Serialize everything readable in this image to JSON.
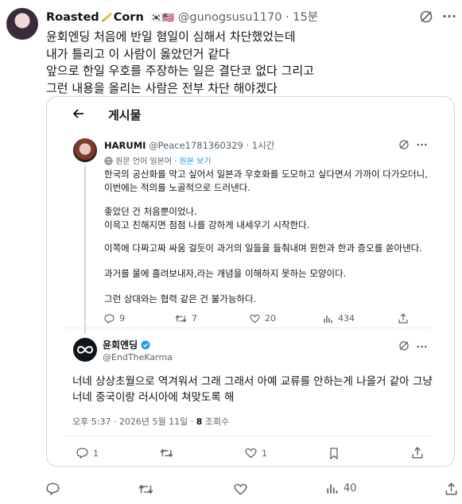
{
  "tweet": {
    "display_name": "Roasted",
    "name_suffix": "Corn",
    "flags": "🇰🇷🇺🇸",
    "handle": "@gunogsusu1170",
    "time": "· 15분",
    "lines": [
      "윤회엔딩 처음에 반일 혐일이 심해서 차단했었는데",
      "내가 틀리고 이 사람이 옳았던거 같다",
      "앞으로 한일 우호를 주장하는 일은 결단코 없다 그리고",
      "그런 내용을 올리는 사람은 전부 차단 해야겠다"
    ],
    "views": "40"
  },
  "embedded": {
    "header_title": "게시물",
    "quoted": {
      "name": "HARUMI",
      "handle": "@Peace1781360329",
      "time": "· 1시간",
      "translate_note": "원문 언어 일본어",
      "translate_link": "원본 보기",
      "paragraphs": [
        "한국의 공산화를 막고 싶어서 일본과 우호화를 도모하고 싶다면서 가까이 다가오더니,",
        "이번에는 적의를 노골적으로 드러낸다.",
        "좋았던 건 처음뿐이었나.",
        "이윽고 친해지면 점점 나를 강하게 내세우기 시작한다.",
        "이쪽에 다짜고짜 싸움 걸듯이 과거의 일들을 들춰내며 원한과 한과 증오를 쏟아낸다.",
        "과거를 물에 흘려보내자,라는 개념을 이해하지 못하는 모양이다.",
        "그런 상대와는 협력 같은 건 불가능하다."
      ],
      "stats": {
        "replies": "9",
        "retweets": "7",
        "likes": "20",
        "views": "434"
      }
    },
    "reply": {
      "name": "윤회엔딩",
      "handle": "@EndTheKarma",
      "lines": [
        "너네 상상초월으로 역겨워서 그래 그래서 아예 교류를 안하는게 나을거 같아 그냥",
        "너네 중국이랑 러시아에 쳐맞도록 해"
      ],
      "time_meta": "오후 5:37 · 2026년 5월 11일 · ",
      "views_count": "8",
      "views_label": " 조회수",
      "stats": {
        "replies": "1",
        "likes": "1"
      }
    }
  },
  "colors": {
    "verified": "#1d9bf0",
    "link": "#1d9bf0",
    "muted": "#536471"
  },
  "icons": [
    "grok-icon",
    "more-icon",
    "back-arrow-icon",
    "reply-icon",
    "retweet-icon",
    "like-icon",
    "views-icon",
    "share-icon",
    "globe-icon",
    "verified-badge-icon",
    "corn-icon"
  ]
}
